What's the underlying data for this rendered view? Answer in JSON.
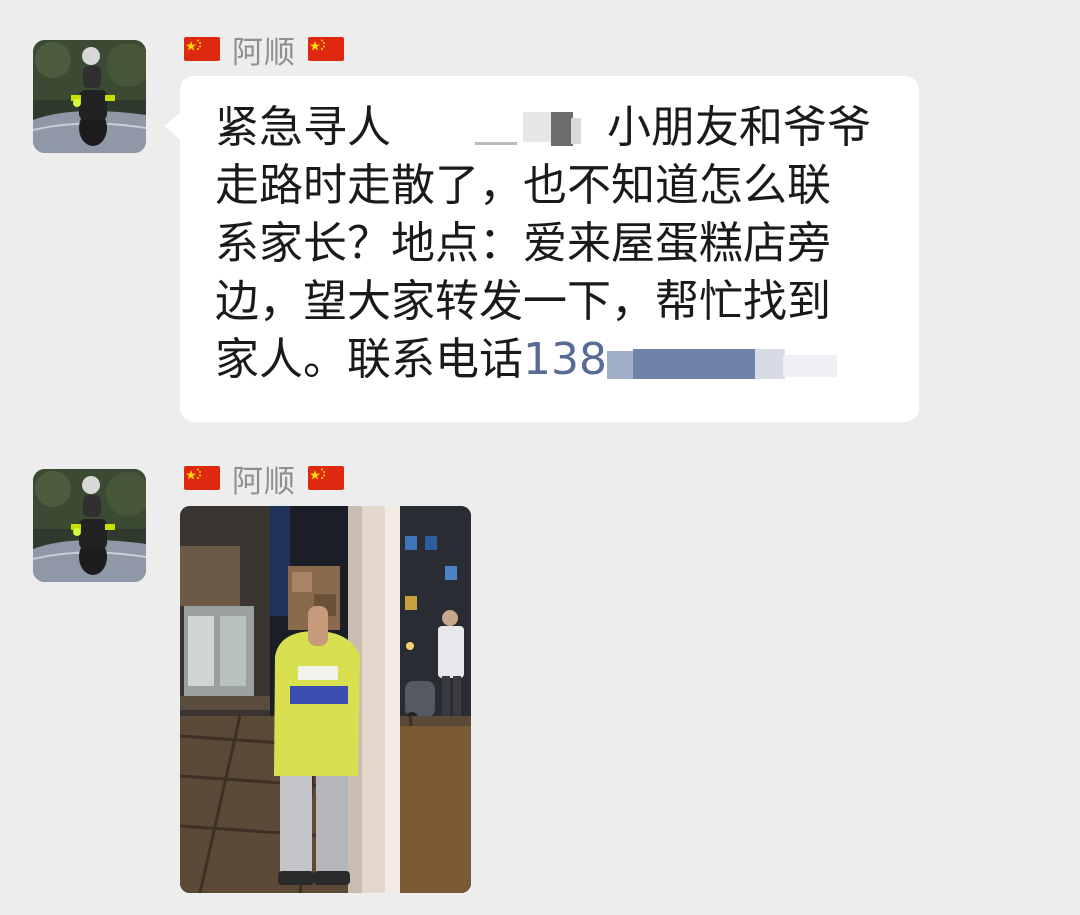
{
  "messages": [
    {
      "sender": "阿顺",
      "avatar": "motorcycle-rider-avatar",
      "type": "text",
      "lines": [
        "紧急寻人",
        "小朋友和爷爷",
        "走路时走散了，也不知道怎么联",
        "系家长？地点：爱来屋蛋糕店旁",
        "边，望大家转发一下，帮忙找到",
        "家人。联系电话",
        "138"
      ]
    },
    {
      "sender": "阿顺",
      "avatar": "motorcycle-rider-avatar",
      "type": "image",
      "image": "photo-child-by-pole"
    }
  ],
  "icons": {
    "flag": "china-flag-icon"
  },
  "colors": {
    "background": "#ededed",
    "bubble": "#ffffff",
    "sender_name": "#8f8f8f",
    "phone_link": "#576b95",
    "flag_red": "#de2910",
    "flag_star": "#ffde00"
  }
}
